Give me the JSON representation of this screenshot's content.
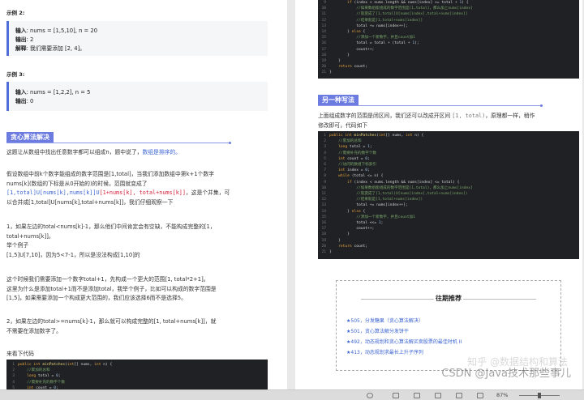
{
  "left": {
    "example2": {
      "label": "示例 2:",
      "input_label": "输入",
      "input_value": ": nums = [1,5,10], n = 20",
      "output_label": "输出",
      "output_value": ": 2",
      "explain_label": "解释",
      "explain_value": ": 我们需要添加 [2, 4]。"
    },
    "example3": {
      "label": "示例 3:",
      "input_label": "输入",
      "input_value": ": nums = [1,2,2], n = 5",
      "output_label": "输出",
      "output_value": ": 0"
    },
    "heading": "贪心算法解决",
    "p1_text": "这题让从数组中找出任意数字都可以组成n，题中说了，",
    "p1_link": "数组是排序的。",
    "p2_l1": "假设数组中前k个数字能组成的数字范围是[1,total]，当我们添加数组中第k+1个数字",
    "p2_l2": "nums[k](数组的下标是从0开始的)的时候，范围就变成了",
    "p2_l3a": "[1,total]U[nums[k],nums[k]]U",
    "p2_l3b": "[1+nums[k], total+nums[k]]",
    "p2_l3c": "，这是个并集，可",
    "p2_l4": "以合并成[1,total]U[nums[k],total+nums[k]]，我们仔细观察一下",
    "p3_l1": "1，如果左边的total<nums[k]-1，那么他们中间肯定会有空缺，不能构成完整的[1，",
    "p3_l2": "total+nums[k]]。",
    "p3_l3": "举个例子",
    "p3_l4": "[1,5]U[7,10]，因为5<7-1，所以是没法构成[1,10]的",
    "p4_l1": "这个时候我们需要添加一个数字total+1，先构成一个更大的范围[1, total*2+1]。",
    "p4_l2": "这里为什么是添加total+1而不是添加total，我举个例子，比如可以构成的数字范围是",
    "p4_l3": "[1,5]，如果需要添加一个构成更大范围的，我们应该选择6而不是选择5。",
    "p5_l1": "2，如果左边的total>=nums[k]-1，那么就可以构成完整的[1, total+nums[k]]，就",
    "p5_l2": "不需要在添加数字了。",
    "p6": "来看下代码",
    "code": [
      {
        "ln": "1",
        "text": "public int minPatches(int[] nums, int n) {"
      },
      {
        "ln": "2",
        "text": "    //累加的总和"
      },
      {
        "ln": "3",
        "text": "    long total = 0;"
      },
      {
        "ln": "4",
        "text": "    //需要补充的数字个数"
      },
      {
        "ln": "5",
        "text": "    int count = 0;"
      }
    ]
  },
  "right": {
    "code_top": [
      {
        "ln": "9",
        "text": "        if (index < nums.length && nums[index] <= total + 1) {"
      },
      {
        "ln": "10",
        "text": "            //如果数组能组成的数字范围是[1,total]，那么加上nums[index]"
      },
      {
        "ln": "11",
        "text": "            //就变成了[1,total]U[nums[index],total+nums[index]]"
      },
      {
        "ln": "12",
        "text": "            //结果就是[1,total+nums[index]]"
      },
      {
        "ln": "13",
        "text": "            total += nums[index++];"
      },
      {
        "ln": "14",
        "text": "        } else {"
      },
      {
        "ln": "15",
        "text": "            //添加一个新数字，并且count加1"
      },
      {
        "ln": "16",
        "text": "            total = total + (total + 1);"
      },
      {
        "ln": "17",
        "text": "            count++;"
      },
      {
        "ln": "18",
        "text": "        }"
      },
      {
        "ln": "19",
        "text": "    }"
      },
      {
        "ln": "20",
        "text": "    return count;"
      },
      {
        "ln": "21",
        "text": "}"
      }
    ],
    "heading": "另一种写法",
    "p1_l1a": "上面组成数字的范围是闭区间，我们还可以改成开区间 ",
    "p1_l1b": "[1, total)",
    "p1_l1c": "，原理都一样，稍作",
    "p1_l2": "修改即可，代码如下",
    "code2": [
      {
        "ln": "1",
        "text": "public int minPatches(int[] nums, int n) {"
      },
      {
        "ln": "2",
        "text": "    //累加的总和"
      },
      {
        "ln": "3",
        "text": "    long total = 1;"
      },
      {
        "ln": "4",
        "text": "    //需要补充的数字个数"
      },
      {
        "ln": "5",
        "text": "    int count = 0;"
      },
      {
        "ln": "6",
        "text": "    //访问的数组下标索引"
      },
      {
        "ln": "7",
        "text": "    int index = 0;"
      },
      {
        "ln": "8",
        "text": "    while (total <= n) {"
      },
      {
        "ln": "9",
        "text": "        if (index < nums.length && nums[index] <= total) {"
      },
      {
        "ln": "10",
        "text": "            //如果数组能组成的数字范围是[1,total)，那么加上nums[index]"
      },
      {
        "ln": "11",
        "text": "            //就变成了[1,total)U[nums[index],total+nums[index])"
      },
      {
        "ln": "12",
        "text": "            //结果就是[1,total+nums[index])"
      },
      {
        "ln": "13",
        "text": "            total += nums[index++];"
      },
      {
        "ln": "14",
        "text": "        } else {"
      },
      {
        "ln": "15",
        "text": "            //添加一个新数字，并且count加1"
      },
      {
        "ln": "16",
        "text": "            total <<= 1;"
      },
      {
        "ln": "17",
        "text": "            count++;"
      },
      {
        "ln": "18",
        "text": "        }"
      },
      {
        "ln": "19",
        "text": "    }"
      },
      {
        "ln": "20",
        "text": "    return count;"
      },
      {
        "ln": "21",
        "text": "}"
      }
    ],
    "rec_title": "往期推荐",
    "rec_items": [
      "★505，分发糖果（贪心算法解决）",
      "★501，贪心算法解分发饼干",
      "★492，动态规划和贪心算法解买卖股票的最佳时机 II",
      "★413，动态规划求最长上升子序列"
    ],
    "watermark_back": "知乎 @数据结构和算法",
    "watermark_front": "CSDN @Java技术那些事儿"
  },
  "statusbar": {
    "zoom": "87%"
  },
  "colors": {
    "accent": "#6b7be0",
    "link": "#3b64d1",
    "highlight_red": "#d7263d",
    "code_bg": "#1f2124"
  }
}
